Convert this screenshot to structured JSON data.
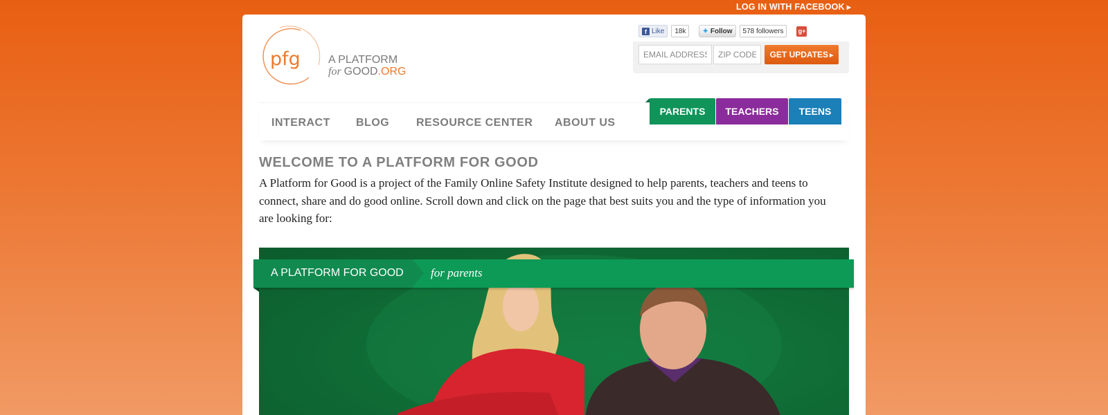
{
  "header": {
    "facebook_login": "LOG IN WITH FACEBOOK",
    "logo": {
      "mark": "pfg",
      "line1": "A PLATFORM",
      "line2_for": "for",
      "line2_good": "GOOD",
      "line2_org": ".ORG"
    },
    "social": {
      "like_label": "Like",
      "like_count": "18k",
      "follow_label": "Follow",
      "followers": "578 followers",
      "gplus_icon": "google-plus-icon"
    },
    "signup": {
      "email_placeholder": "EMAIL ADDRESS",
      "zip_placeholder": "ZIP CODE",
      "button_label": "GET UPDATES"
    }
  },
  "nav": {
    "items": [
      {
        "label": "INTERACT"
      },
      {
        "label": "BLOG"
      },
      {
        "label": "RESOURCE CENTER"
      },
      {
        "label": "ABOUT US"
      }
    ],
    "audience_tabs": [
      {
        "label": "PARENTS",
        "color": "#10945a"
      },
      {
        "label": "TEACHERS",
        "color": "#8b2c9c"
      },
      {
        "label": "TEENS",
        "color": "#1b7fb8"
      }
    ]
  },
  "main": {
    "title": "WELCOME TO A PLATFORM FOR GOOD",
    "body": "A Platform for Good is a project of the Family Online Safety Institute designed to help parents, teachers and teens to connect, share and do good online. Scroll down and click on the page that best suits you and the type of information you are looking for:",
    "hero": {
      "ribbon_title": "A PLATFORM FOR GOOD",
      "ribbon_subtitle": "for parents"
    }
  },
  "colors": {
    "brand_orange": "#e85f12",
    "parents_green": "#10945a",
    "teachers_purple": "#8b2c9c",
    "teens_blue": "#1b7fb8"
  }
}
